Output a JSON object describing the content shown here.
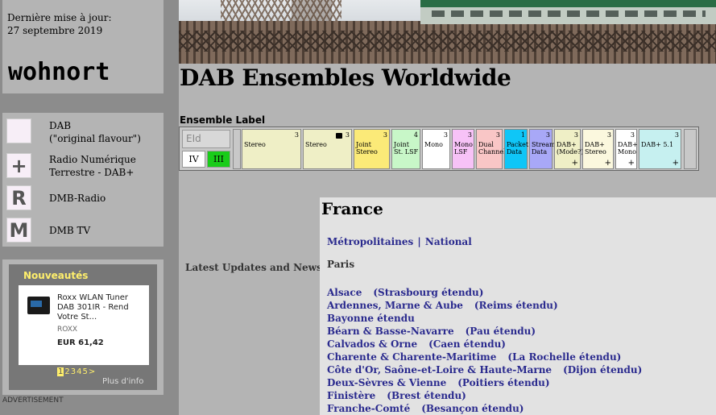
{
  "sidebar": {
    "last_update_label": "Dernière mise à jour:",
    "last_update_date": "27 septembre 2019",
    "logo": "wohnort",
    "legend": [
      {
        "icon": "",
        "icon_name": "dab-original-icon",
        "text1": "DAB",
        "text2": "(\"original flavour\")"
      },
      {
        "icon": "+",
        "icon_name": "dab-plus-icon",
        "text1": "Radio Numérique",
        "text2": "Terrestre - DAB+"
      },
      {
        "icon": "R",
        "icon_name": "dmb-radio-icon",
        "text1": "DMB-Radio",
        "text2": ""
      },
      {
        "icon": "M",
        "icon_name": "dmb-tv-icon",
        "text1": "DMB TV",
        "text2": ""
      }
    ],
    "news_widget": {
      "title": "Nouveautés",
      "product_name": "Roxx WLAN Tuner DAB 301IR - Rend Votre St...",
      "brand": "ROXX",
      "price": "EUR 61,42",
      "pages": [
        "1",
        "2",
        "3",
        "4",
        "5",
        ">"
      ],
      "more": "Plus d'info"
    },
    "advertisement": "ADVERTISEMENT"
  },
  "header": {
    "title": "DAB Ensembles Worldwide"
  },
  "ensemble_bar": {
    "label": "Ensemble Label",
    "eid_placeholder": "EId",
    "band_iv": "IV",
    "band_iii": "III",
    "cells": [
      {
        "label": "Stereo",
        "num": "3",
        "color": "#efefc6",
        "plus": "",
        "lock": false
      },
      {
        "label": "Stereo",
        "num": "3",
        "color": "#efefc6",
        "plus": "",
        "lock": true
      },
      {
        "label": "Joint Stereo",
        "num": "3",
        "color": "#fbea78",
        "plus": "",
        "lock": false
      },
      {
        "label": "Joint St. LSF",
        "num": "4",
        "color": "#c8f7c8",
        "plus": "",
        "lock": false
      },
      {
        "label": "Mono",
        "num": "3",
        "color": "#ffffff",
        "plus": "",
        "lock": false
      },
      {
        "label": "Mono LSF",
        "num": "3",
        "color": "#f7c2f7",
        "plus": "",
        "lock": false
      },
      {
        "label": "Dual Channel",
        "num": "3",
        "color": "#f9c6c6",
        "plus": "",
        "lock": false
      },
      {
        "label": "Packet Data",
        "num": "1",
        "color": "#0fc6f7",
        "plus": "",
        "lock": false
      },
      {
        "label": "Stream Data",
        "num": "3",
        "color": "#a8a8f7",
        "plus": "",
        "lock": false
      },
      {
        "label": "DAB+ (Mode?)",
        "num": "3",
        "color": "#efefc6",
        "plus": "+",
        "lock": false
      },
      {
        "label": "DAB+ Stereo",
        "num": "3",
        "color": "#fbf8de",
        "plus": "+",
        "lock": false
      },
      {
        "label": "DAB+ Mono",
        "num": "3",
        "color": "#ffffff",
        "plus": "+",
        "lock": false
      },
      {
        "label": "DAB+ 5.1",
        "num": "3",
        "color": "#c6f0f0",
        "plus": "+",
        "lock": false
      }
    ]
  },
  "side_news": "Latest Updates and News",
  "content": {
    "country": "France",
    "national_link1": "Métropolitaines",
    "national_sep": "|",
    "national_link2": "National",
    "city": "Paris",
    "regions": [
      {
        "name": "Alsace",
        "ext": "(Strasbourg étendu)"
      },
      {
        "name": "Ardennes, Marne & Aube",
        "ext": "(Reims étendu)"
      },
      {
        "name": "Bayonne étendu",
        "ext": ""
      },
      {
        "name": "Béarn & Basse-Navarre",
        "ext": "(Pau étendu)"
      },
      {
        "name": "Calvados & Orne",
        "ext": "(Caen étendu)"
      },
      {
        "name": "Charente & Charente-Maritime",
        "ext": "(La Rochelle étendu)"
      },
      {
        "name": "Côte d'Or, Saône-et-Loire & Haute-Marne",
        "ext": "(Dijon étendu)"
      },
      {
        "name": "Deux-Sèvres & Vienne",
        "ext": "(Poitiers étendu)"
      },
      {
        "name": "Finistère",
        "ext": "(Brest étendu)"
      },
      {
        "name": "Franche-Comté",
        "ext": "(Besançon étendu)"
      }
    ]
  }
}
